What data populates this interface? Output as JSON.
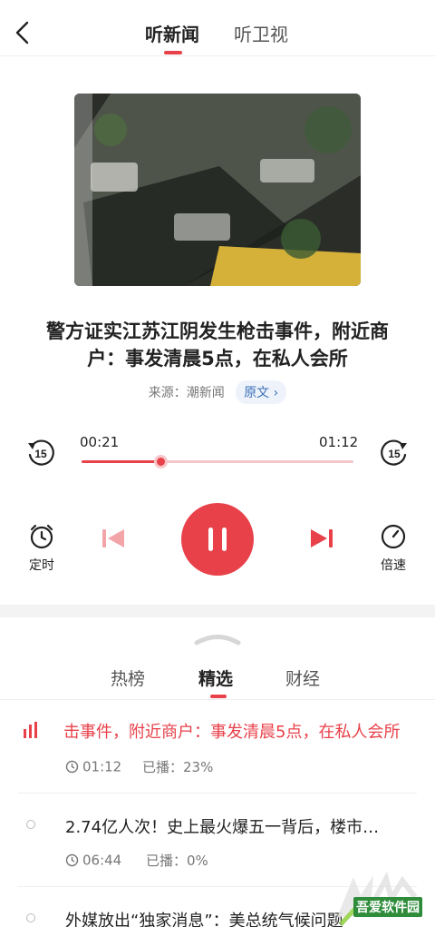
{
  "header": {
    "tabs": [
      {
        "label": "听新闻",
        "active": true
      },
      {
        "label": "听卫视",
        "active": false
      }
    ],
    "accent": "#e8414a"
  },
  "article": {
    "title": "警方证实江苏江阴发生枪击事件，附近商户：事发清晨5点，在私人会所",
    "source_label": "来源：潮新闻",
    "original_button": "原文"
  },
  "player": {
    "current_time": "00:21",
    "total_time": "01:12",
    "progress_percent": 29,
    "rewind_label": "15",
    "forward_label": "15",
    "timer_label": "定时",
    "speed_label": "倍速"
  },
  "lists": {
    "tabs": [
      {
        "label": "热榜",
        "active": false
      },
      {
        "label": "精选",
        "active": true
      },
      {
        "label": "财经",
        "active": false
      }
    ],
    "items": [
      {
        "title": "击事件，附近商户：事发清晨5点，在私人会所",
        "duration": "01:12",
        "played": "已播：23%",
        "playing": true
      },
      {
        "title": "2.74亿人次！史上最火爆五一背后，楼市…",
        "duration": "06:44",
        "played": "已播：0%",
        "playing": false
      },
      {
        "title": "外媒放出“独家消息”：美总统气候问题",
        "duration": "",
        "played": "",
        "playing": false
      }
    ]
  },
  "watermark": {
    "text": "吾爱软件园"
  }
}
